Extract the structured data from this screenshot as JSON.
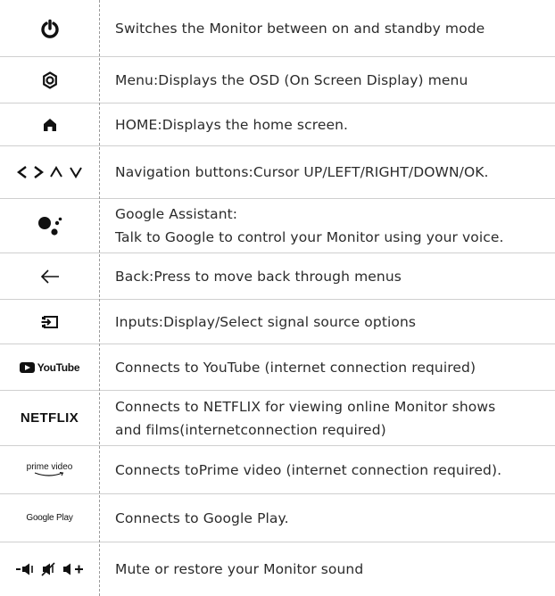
{
  "rows": [
    {
      "icon": "power-icon",
      "lines": [
        "Switches the Monitor between on and standby mode"
      ]
    },
    {
      "icon": "menu-gear-icon",
      "lines": [
        "Menu:Displays the OSD (On Screen Display) menu"
      ]
    },
    {
      "icon": "home-icon",
      "lines": [
        "HOME:Displays the home screen."
      ]
    },
    {
      "icon": "navigation-arrows-icon",
      "lines": [
        "Navigation buttons:Cursor UP/LEFT/RIGHT/DOWN/OK."
      ]
    },
    {
      "icon": "google-assistant-icon",
      "lines": [
        "Google Assistant:",
        "Talk to Google to control your Monitor using your voice."
      ]
    },
    {
      "icon": "back-arrow-icon",
      "lines": [
        "Back:Press to move back through menus"
      ]
    },
    {
      "icon": "input-source-icon",
      "lines": [
        "Inputs:Display/Select signal source options"
      ]
    },
    {
      "icon": "youtube-logo",
      "logo_text": "YouTube",
      "lines": [
        "Connects to YouTube (internet connection required)"
      ]
    },
    {
      "icon": "netflix-logo",
      "logo_text": "NETFLIX",
      "lines": [
        "Connects to NETFLIX for viewing online Monitor shows",
        "and films(internetconnection required)"
      ]
    },
    {
      "icon": "prime-video-logo",
      "logo_text": "prime video",
      "lines": [
        "Connects toPrime video (internet connection required)."
      ]
    },
    {
      "icon": "google-play-logo",
      "logo_text": "Google Play",
      "lines": [
        "Connects to Google Play."
      ]
    },
    {
      "icon": "volume-mute-icons",
      "lines": [
        "Mute or restore your Monitor sound"
      ]
    }
  ]
}
